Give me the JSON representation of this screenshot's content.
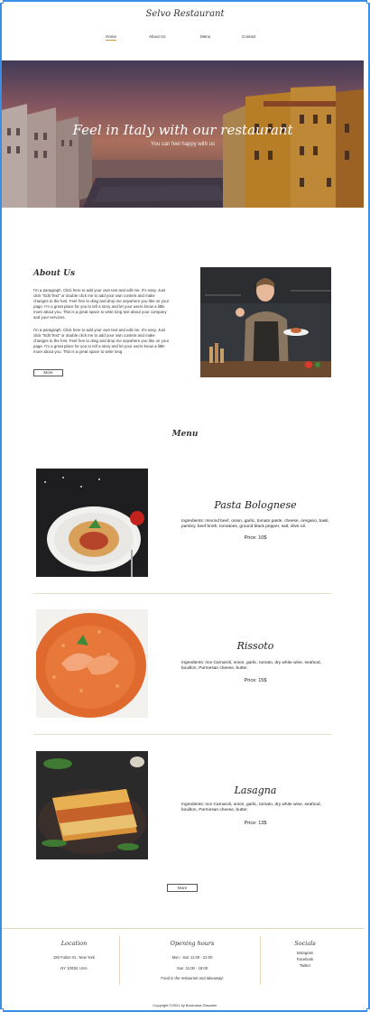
{
  "header": {
    "brand": "Selvo Restaurant",
    "nav": [
      {
        "label": "Home",
        "active": true
      },
      {
        "label": "About Us",
        "active": false
      },
      {
        "label": "Menu",
        "active": false
      },
      {
        "label": "Contact",
        "active": false
      }
    ]
  },
  "hero": {
    "title": "Feel in Italy with our restaurant",
    "subtitle": "You can feel happy with us"
  },
  "about": {
    "title": "About Us",
    "paragraph1": "I'm a paragraph. Click here to add your own text and edit me. It's easy. Just click \"Edit Text\" or double click me to add your own content and make changes to the font. Feel free to drag and drop me anywhere you like on your page. I'm a great place for you to tell a story and let your users know a little more about you. This is a great space to write long text about your company and your services.",
    "paragraph2": "I'm a paragraph. Click here to add your own text and edit me. It's easy. Just click \"Edit Text\" or double click me to add your own content and make changes to the font. Feel free to drag and drop me anywhere you like on your page. I'm a great place for you to tell a story and let your users know a little more about you. This is a great space to write long",
    "more_label": "More"
  },
  "menu": {
    "title": "Menu",
    "dishes": [
      {
        "name": "Pasta Bolognese",
        "ingredients": "Ingredients: minced beef, onion, garlic, tomato paste, cheese, oregano, basil, parsley, beef broth, tomatoes, ground black pepper, salt, olive oil.",
        "price": "Price: 10$"
      },
      {
        "name": "Rissoto",
        "ingredients": "Ingredients: rice Carnaroli, onion, garlic, tomato, dry white wine, seafood, bouillon, Parmesan cheese, butter.",
        "price": "Price: 15$"
      },
      {
        "name": "Lasagna",
        "ingredients": "Ingredients: rice Carnaroli, onion, garlic, tomato, dry white wine, seafood, bouillon, Parmesan cheese, butter.",
        "price": "Price: 13$"
      }
    ],
    "more_label": "More"
  },
  "footer": {
    "location": {
      "title": "Location",
      "line1": "150 Fulton St., New York",
      "line2": "NY 10038, USA"
    },
    "hours": {
      "title": "Opening hours",
      "line1": "Mon - Sat: 11:00 - 22:00",
      "line2": "Sun: 11:00 - 19:00",
      "line3": "Food in the restaurant and takeaway!"
    },
    "socials": {
      "title": "Socials",
      "links": [
        "Instagram",
        "Facebook",
        "Twitter"
      ]
    },
    "copyright": "Copyright ©2021 by Bordoana Glauzber"
  },
  "colors": {
    "frame": "#3b8ee6",
    "accent": "#c89a3c",
    "divider": "#e8dcc3"
  }
}
